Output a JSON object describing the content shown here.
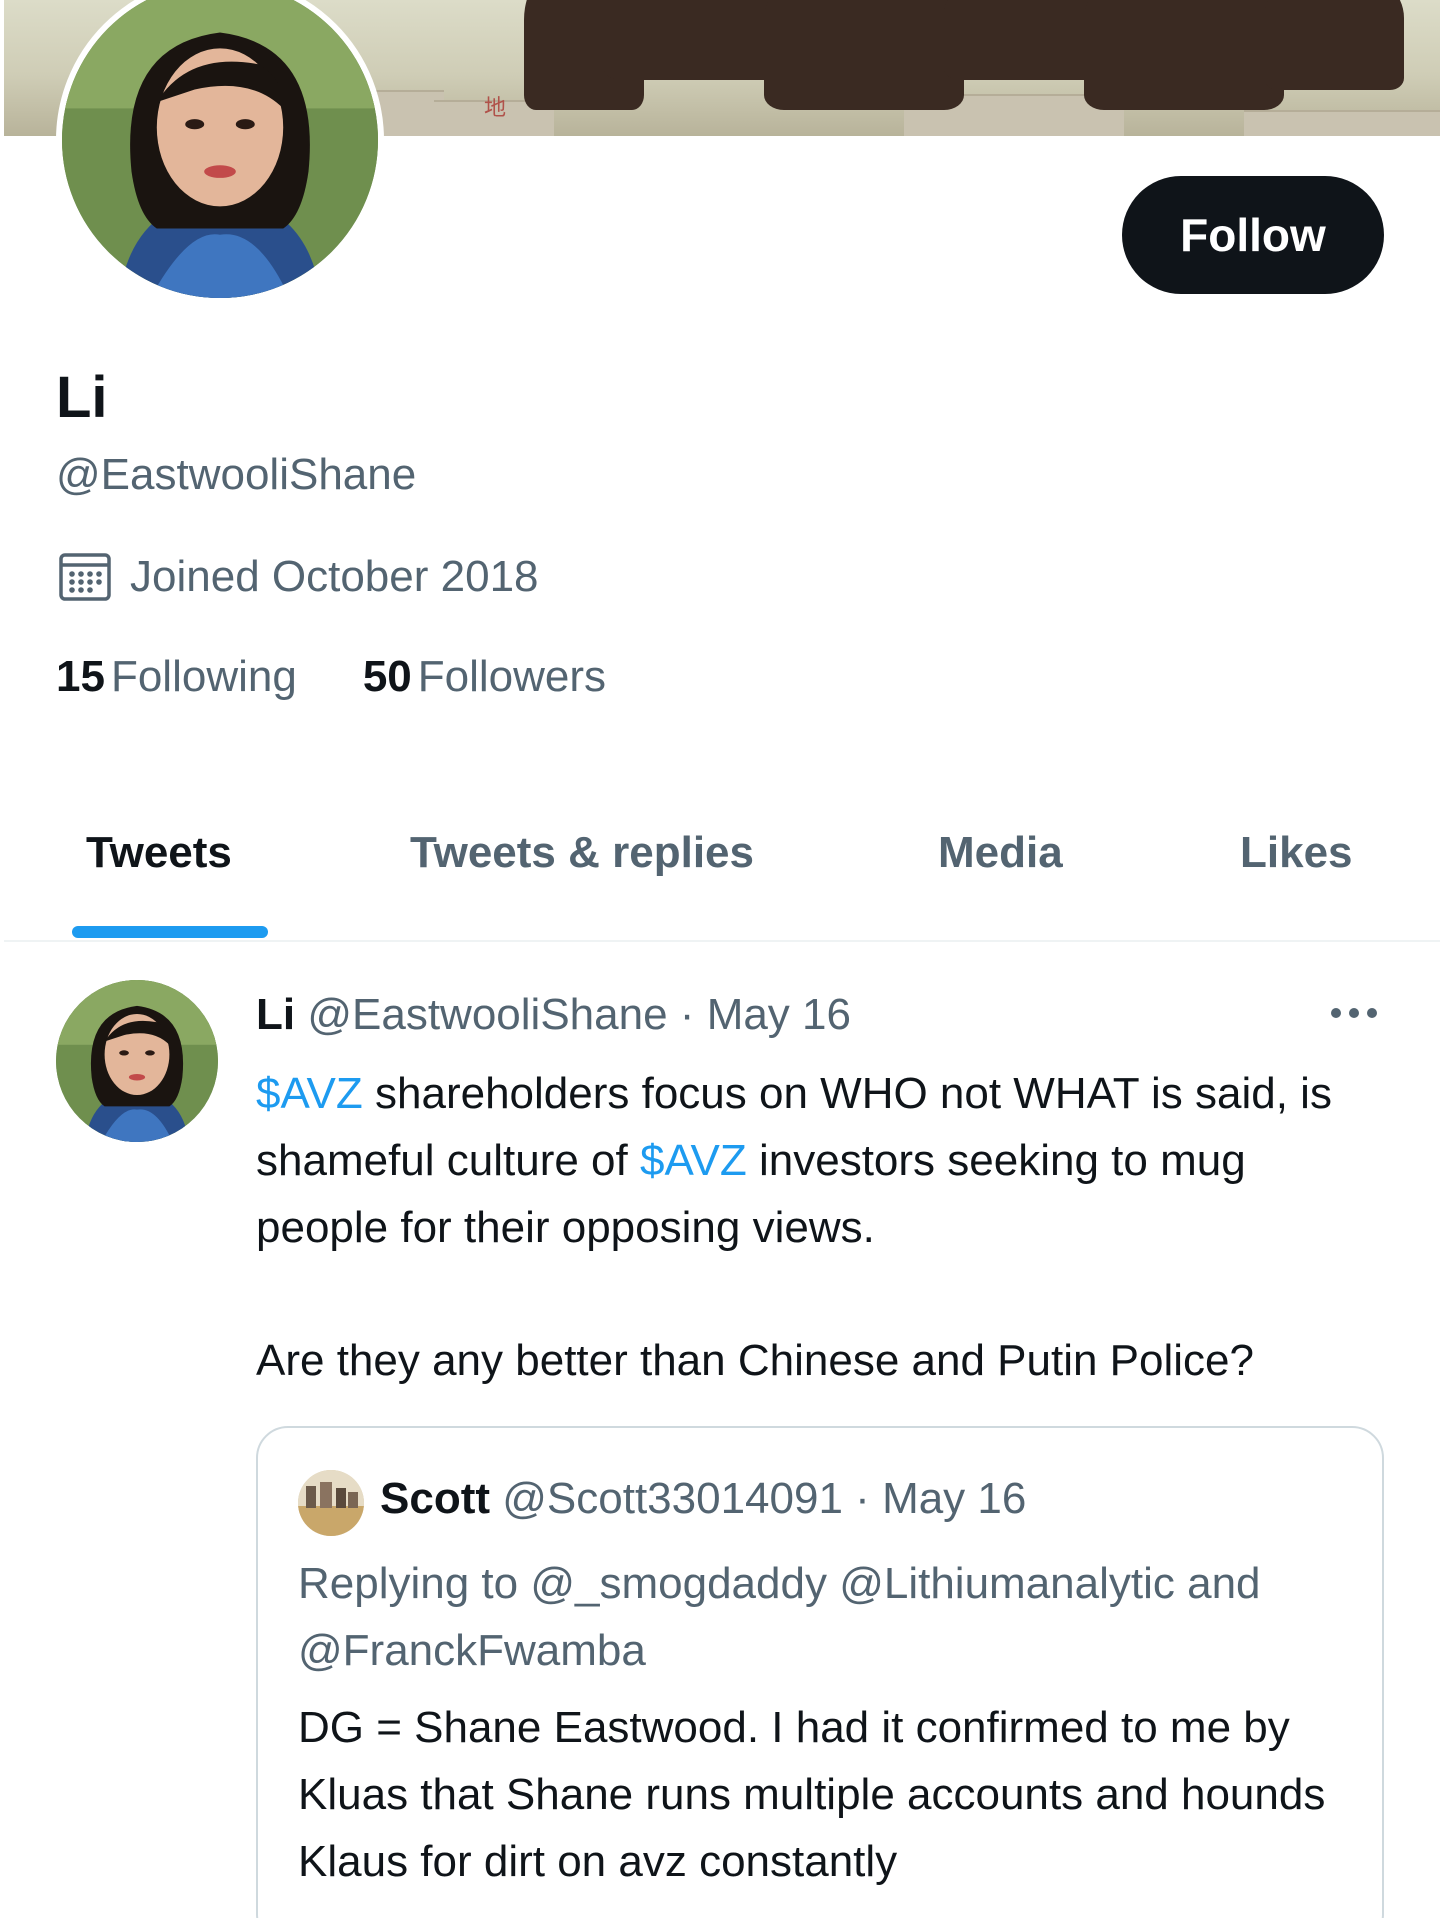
{
  "profile": {
    "name": "Li",
    "handle": "@EastwooliShane",
    "joined": "Joined October 2018",
    "following_count": "15",
    "following_label": "Following",
    "followers_count": "50",
    "followers_label": "Followers",
    "follow_label": "Follow",
    "banner_sign": "地"
  },
  "tabs": [
    {
      "label": "Tweets",
      "active": true
    },
    {
      "label": "Tweets & replies",
      "active": false
    },
    {
      "label": "Media",
      "active": false
    },
    {
      "label": "Likes",
      "active": false
    }
  ],
  "tweet": {
    "author_name": "Li",
    "author_handle": "@EastwooliShane",
    "separator": "·",
    "date": "May 16",
    "line1_tag": "$AVZ",
    "line1_rest": " shareholders focus on WHO not WHAT is said, is shameful culture of ",
    "line2_tag": "$AVZ",
    "line2_rest": " investors seeking to mug people for their opposing views.",
    "paragraph2": "Are they any better than Chinese and Putin Police?",
    "quote": {
      "author_name": "Scott",
      "author_handle": "@Scott33014091",
      "separator": "·",
      "date": "May 16",
      "replying": "Replying to @_smogdaddy @Lithiumanalytic and @FranckFwamba",
      "text": "DG = Shane Eastwood. I had it confirmed to me by Kluas that Shane runs multiple accounts and hounds Klaus for dirt on avz constantly"
    }
  },
  "colors": {
    "accent": "#1d9bf0",
    "text_primary": "#0f1419",
    "text_secondary": "#536471",
    "follow_button": "#0f1419"
  },
  "icons": {
    "joined": "calendar-icon",
    "more": "more-dots-icon"
  }
}
